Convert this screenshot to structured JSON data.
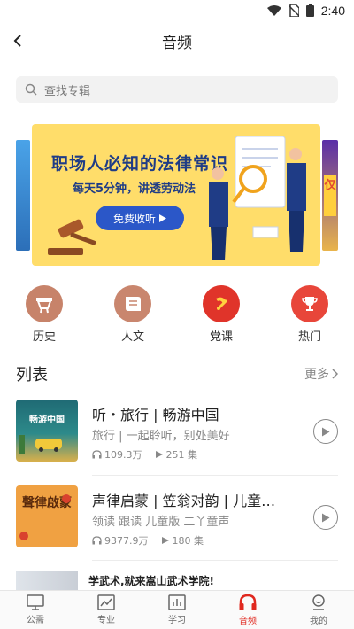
{
  "status_bar": {
    "time": "2:40"
  },
  "header": {
    "title": "音频"
  },
  "search": {
    "placeholder": "查找专辑"
  },
  "banner": {
    "title": "职场人必知的法律常识",
    "subtitle": "每天5分钟，讲透劳动法",
    "button_label": "免费收听",
    "right_peek_text": "仅",
    "colors": {
      "background": "#ffdd6a",
      "title": "#1f3c86",
      "button": "#2b57c8"
    }
  },
  "categories": [
    {
      "label": "历史",
      "icon": "history-icon",
      "color": "#c7836a"
    },
    {
      "label": "人文",
      "icon": "culture-icon",
      "color": "#c9866e"
    },
    {
      "label": "党课",
      "icon": "party-icon",
      "color": "#e0342a"
    },
    {
      "label": "热门",
      "icon": "trophy-icon",
      "color": "#e8463a"
    }
  ],
  "list_section": {
    "title": "列表",
    "more_label": "更多"
  },
  "items": [
    {
      "title": "听・旅行 | 畅游中国",
      "desc": "旅行 | 一起聆听，别处美好",
      "plays": "109.3万",
      "episodes": "251 集",
      "cover_text": "畅游中国"
    },
    {
      "title": "声律启蒙 | 笠翁对韵 | 儿童…",
      "desc": "领读 跟读 儿童版 二丫童声",
      "plays": "9377.9万",
      "episodes": "180 集",
      "cover_text": "聲律啟蒙"
    }
  ],
  "ad": {
    "text": "学武术,就来嵩山武术学院!"
  },
  "tabbar": [
    {
      "label": "公需",
      "icon": "monitor-icon",
      "active": false
    },
    {
      "label": "专业",
      "icon": "chart-icon",
      "active": false
    },
    {
      "label": "学习",
      "icon": "bar-chart-icon",
      "active": false
    },
    {
      "label": "音频",
      "icon": "headphones-icon",
      "active": true
    },
    {
      "label": "我的",
      "icon": "profile-icon",
      "active": false
    }
  ],
  "colors": {
    "accent": "#e0281f",
    "gray_text": "#888888"
  }
}
